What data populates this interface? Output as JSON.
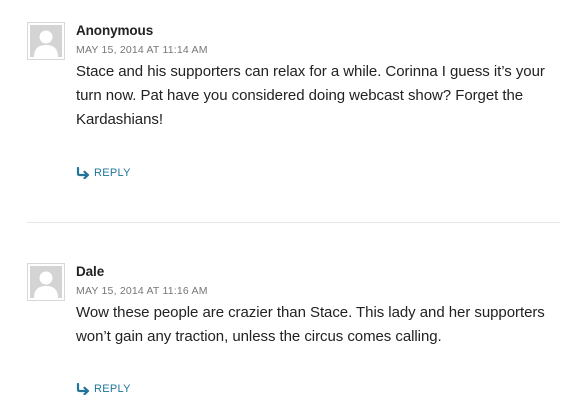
{
  "comments": [
    {
      "author": "Anonymous",
      "date": "MAY 15, 2014 AT 11:14 AM",
      "text": "Stace and his supporters can relax for a while. Corinna I guess it’s your turn now. Pat have you considered doing webcast show? Forget the Kardashians!",
      "reply_label": "REPLY"
    },
    {
      "author": "Dale",
      "date": "MAY 15, 2014 AT 11:16 AM",
      "text": "Wow these people are crazier than Stace. This lady and her support­ers won’t gain any traction, unless the circus comes calling.",
      "reply_label": "REPLY"
    }
  ],
  "colors": {
    "link": "#21759b",
    "meta": "#767676",
    "avatar_bg": "#d4d4d4"
  },
  "icons": {
    "avatar": "default-avatar-icon",
    "reply": "reply-arrow-icon"
  }
}
